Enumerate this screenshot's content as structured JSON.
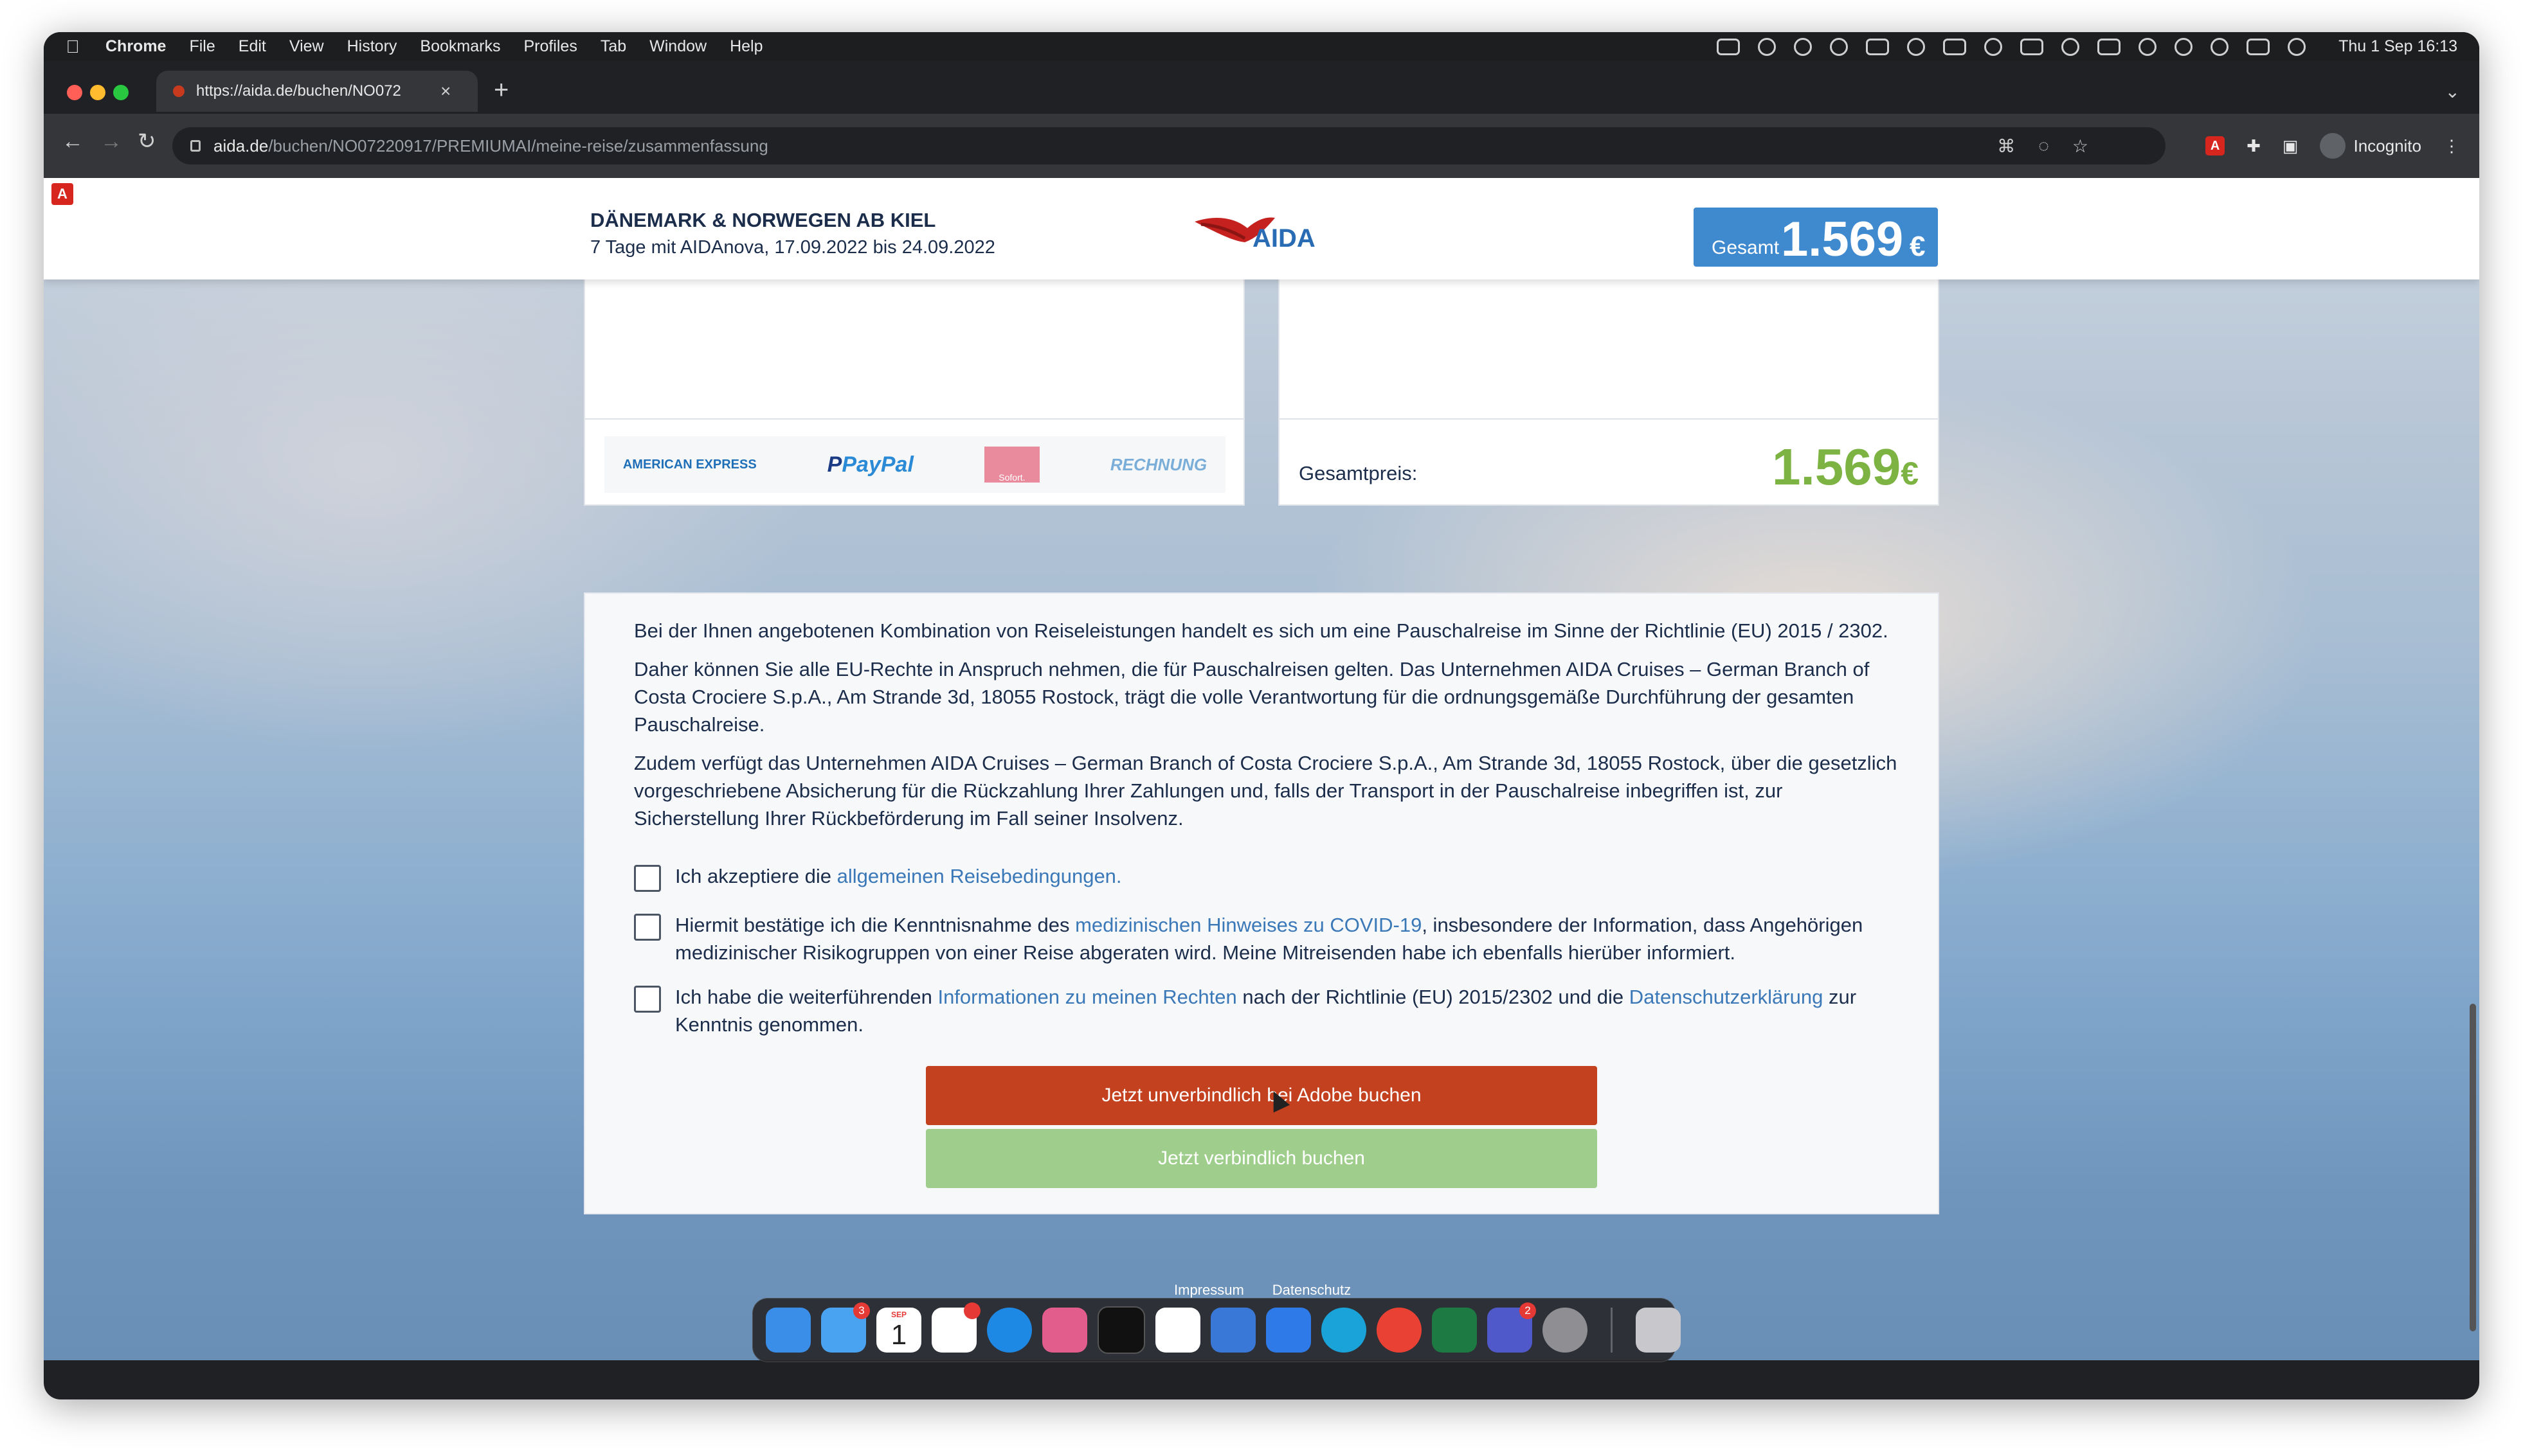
{
  "macos_menubar": {
    "app_name": "Chrome",
    "menus": [
      "File",
      "Edit",
      "View",
      "History",
      "Bookmarks",
      "Profiles",
      "Tab",
      "Window",
      "Help"
    ],
    "clock": "Thu 1 Sep  16:13"
  },
  "browser": {
    "tab_title": "https://aida.de/buchen/NO072",
    "url_host": "aida.de",
    "url_path": "/buchen/NO07220917/PREMIUMAI/meine-reise/zusammenfassung",
    "profile_label": "Incognito"
  },
  "header": {
    "trip_title": "DÄNEMARK & NORWEGEN AB KIEL",
    "trip_subtitle": "7 Tage mit AIDAnova, 17.09.2022 bis 24.09.2022",
    "logo_text": "AIDA",
    "total_label": "Gesamt",
    "total_price": "1.569",
    "currency": "€"
  },
  "payment": {
    "methods": [
      "AMERICAN EXPRESS",
      "PayPal",
      "Sofort.",
      "RECHNUNG"
    ],
    "total_label": "Gesamtpreis:",
    "total_value": "1.569",
    "currency": "€"
  },
  "legal": {
    "para1": "Bei der Ihnen angebotenen Kombination von Reiseleistungen handelt es sich um eine Pauschalreise im Sinne der Richtlinie (EU) 2015 / 2302.",
    "para2": "Daher können Sie alle EU-Rechte in Anspruch nehmen, die für Pauschalreisen gelten. Das Unternehmen AIDA Cruises – German Branch of Costa Crociere S.p.A., Am Strande 3d, 18055 Rostock, trägt die volle Verantwortung für die ordnungsgemäße Durchführung der gesamten Pauschalreise.",
    "para3": "Zudem verfügt das Unternehmen AIDA Cruises – German Branch of Costa Crociere S.p.A., Am Strande 3d, 18055 Rostock, über die gesetzlich vorgeschriebene Absicherung für die Rückzahlung Ihrer Zahlungen und, falls der Transport in der Pauschalreise inbegriffen ist, zur Sicherstellung Ihrer Rückbeförderung im Fall seiner Insolvenz.",
    "cb1_pre": "Ich akzeptiere die ",
    "cb1_link": "allgemeinen Reisebedingungen.",
    "cb2_pre": "Hiermit bestätige ich die Kenntnisnahme des ",
    "cb2_link": "medizinischen Hinweises zu COVID-19",
    "cb2_post": ", insbesondere der Information, dass Angehörigen medizinischer Risikogruppen von einer Reise abgeraten wird. Meine Mitreisenden habe ich ebenfalls hierüber informiert.",
    "cb3_pre": "Ich habe die weiterführenden ",
    "cb3_link1": "Informationen zu meinen Rechten",
    "cb3_mid": " nach der Richtlinie (EU) 2015/2302 und die ",
    "cb3_link2": "Datenschutzerklärung",
    "cb3_post": " zur Kenntnis genommen."
  },
  "buttons": {
    "adobe_book": "Jetzt unverbindlich bei Adobe buchen",
    "book": "Jetzt verbindlich buchen"
  },
  "footer": {
    "impressum": "Impressum",
    "datenschutz": "Datenschutz"
  },
  "dock": {
    "mail_badge": "3",
    "slack_badge": "",
    "teams_badge": "2",
    "calendar_month": "SEP",
    "calendar_day": "1"
  },
  "colors": {
    "accent_blue": "#3f89cf",
    "price_green": "#7cb342",
    "adobe_button": "#c4411f",
    "book_button": "#9fce8c"
  }
}
